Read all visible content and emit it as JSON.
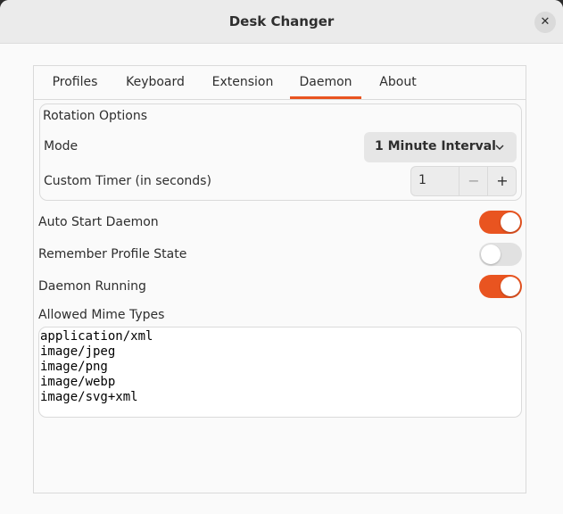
{
  "window": {
    "title": "Desk Changer",
    "close_glyph": "✕"
  },
  "tabs": [
    {
      "label": "Profiles"
    },
    {
      "label": "Keyboard"
    },
    {
      "label": "Extension"
    },
    {
      "label": "Daemon",
      "active": true
    },
    {
      "label": "About"
    }
  ],
  "rotation": {
    "group_label": "Rotation Options",
    "mode_label": "Mode",
    "mode_value": "1 Minute Interval",
    "timer_label": "Custom Timer (in seconds)",
    "timer_value": "1",
    "minus_glyph": "−",
    "plus_glyph": "+"
  },
  "switches": [
    {
      "label": "Auto Start Daemon",
      "on": true
    },
    {
      "label": "Remember Profile State",
      "on": false
    },
    {
      "label": "Daemon Running",
      "on": true
    }
  ],
  "mime": {
    "label": "Allowed Mime Types",
    "types": [
      "application/xml",
      "image/jpeg",
      "image/png",
      "image/webp",
      "image/svg+xml"
    ]
  },
  "colors": {
    "accent": "#e95420",
    "switch_off": "#e1e1e1"
  },
  "icons": {
    "close": "close-icon",
    "dropdown": "chevron-down-icon"
  }
}
